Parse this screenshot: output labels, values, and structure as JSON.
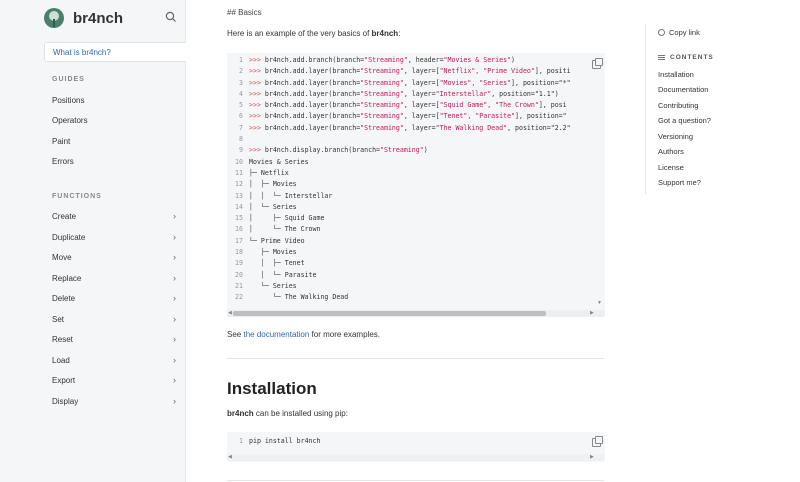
{
  "sidebar": {
    "title": "br4nch",
    "active_item": "What is br4nch?",
    "guides_label": "GUIDES",
    "guides": [
      "Positions",
      "Operators",
      "Paint",
      "Errors"
    ],
    "functions_label": "FUNCTIONS",
    "functions": [
      "Create",
      "Duplicate",
      "Move",
      "Replace",
      "Delete",
      "Set",
      "Reset",
      "Load",
      "Export",
      "Display"
    ]
  },
  "main": {
    "heading_md": "## Basics",
    "intro_pre": "Here is an example of the very basics of ",
    "intro_bold": "br4nch",
    "intro_post": ":",
    "code_lines": [
      {
        "n": "1",
        "prompt": ">>> ",
        "pre": "br4nch.add.branch(branch=",
        "s1": "\"Streaming\"",
        "mid": ", header=",
        "s2": "\"Movies & Series\"",
        "post": ")"
      },
      {
        "n": "2",
        "prompt": ">>> ",
        "pre": "br4nch.add.layer(branch=",
        "s1": "\"Streaming\"",
        "mid": ", layer=[",
        "s2": "\"Netflix\", \"Prime Video\"",
        "post": "], positi"
      },
      {
        "n": "3",
        "prompt": ">>> ",
        "pre": "br4nch.add.layer(branch=",
        "s1": "\"Streaming\"",
        "mid": ", layer=[",
        "s2": "\"Movies\", \"Series\"",
        "post": "], position=\"*\""
      },
      {
        "n": "4",
        "prompt": ">>> ",
        "pre": "br4nch.add.layer(branch=",
        "s1": "\"Streaming\"",
        "mid": ", layer=",
        "s2": "\"Interstellar\"",
        "post": ", position=\"1.1\")"
      },
      {
        "n": "5",
        "prompt": ">>> ",
        "pre": "br4nch.add.layer(branch=",
        "s1": "\"Streaming\"",
        "mid": ", layer=[",
        "s2": "\"Squid Game\", \"The Crown\"",
        "post": "], posi"
      },
      {
        "n": "6",
        "prompt": ">>> ",
        "pre": "br4nch.add.layer(branch=",
        "s1": "\"Streaming\"",
        "mid": ", layer=[",
        "s2": "\"Tenet\", \"Parasite\"",
        "post": "], position=\""
      },
      {
        "n": "7",
        "prompt": ">>> ",
        "pre": "br4nch.add.layer(branch=",
        "s1": "\"Streaming\"",
        "mid": ", layer=",
        "s2": "\"The Walking Dead\"",
        "post": ", position=\"2.2\""
      },
      {
        "n": "8",
        "prompt": "",
        "pre": "",
        "s1": "",
        "mid": "",
        "s2": "",
        "post": ""
      },
      {
        "n": "9",
        "prompt": ">>> ",
        "pre": "br4nch.display.branch(branch=",
        "s1": "\"Streaming\"",
        "mid": ")",
        "s2": "",
        "post": ""
      },
      {
        "n": "10",
        "prompt": "",
        "pre": "Movies & Series",
        "s1": "",
        "mid": "",
        "s2": "",
        "post": ""
      },
      {
        "n": "11",
        "prompt": "",
        "pre": "├─ Netflix",
        "s1": "",
        "mid": "",
        "s2": "",
        "post": ""
      },
      {
        "n": "12",
        "prompt": "",
        "pre": "│  ├─ Movies",
        "s1": "",
        "mid": "",
        "s2": "",
        "post": ""
      },
      {
        "n": "13",
        "prompt": "",
        "pre": "│  │  └─ Interstellar",
        "s1": "",
        "mid": "",
        "s2": "",
        "post": ""
      },
      {
        "n": "14",
        "prompt": "",
        "pre": "│  └─ Series",
        "s1": "",
        "mid": "",
        "s2": "",
        "post": ""
      },
      {
        "n": "15",
        "prompt": "",
        "pre": "│     ├─ Squid Game",
        "s1": "",
        "mid": "",
        "s2": "",
        "post": ""
      },
      {
        "n": "16",
        "prompt": "",
        "pre": "│     └─ The Crown",
        "s1": "",
        "mid": "",
        "s2": "",
        "post": ""
      },
      {
        "n": "17",
        "prompt": "",
        "pre": "└─ Prime Video",
        "s1": "",
        "mid": "",
        "s2": "",
        "post": ""
      },
      {
        "n": "18",
        "prompt": "",
        "pre": "   ├─ Movies",
        "s1": "",
        "mid": "",
        "s2": "",
        "post": ""
      },
      {
        "n": "19",
        "prompt": "",
        "pre": "   │  ├─ Tenet",
        "s1": "",
        "mid": "",
        "s2": "",
        "post": ""
      },
      {
        "n": "20",
        "prompt": "",
        "pre": "   │  └─ Parasite",
        "s1": "",
        "mid": "",
        "s2": "",
        "post": ""
      },
      {
        "n": "21",
        "prompt": "",
        "pre": "   └─ Series",
        "s1": "",
        "mid": "",
        "s2": "",
        "post": ""
      },
      {
        "n": "22",
        "prompt": "",
        "pre": "      └─ The Walking Dead",
        "s1": "",
        "mid": "",
        "s2": "",
        "post": ""
      }
    ],
    "see_pre": "See ",
    "see_link": "the documentation",
    "see_post": " for more examples.",
    "installation_title": "Installation",
    "install_bold": "br4nch",
    "install_text": " can be installed using pip:",
    "pip_line_number": "1",
    "pip_command": "pip install br4nch"
  },
  "toc": {
    "copy_link": "Copy link",
    "contents_label": "CONTENTS",
    "items": [
      "Installation",
      "Documentation",
      "Contributing",
      "Got a question?",
      "Versioning",
      "Authors",
      "License",
      "Support me?"
    ]
  }
}
